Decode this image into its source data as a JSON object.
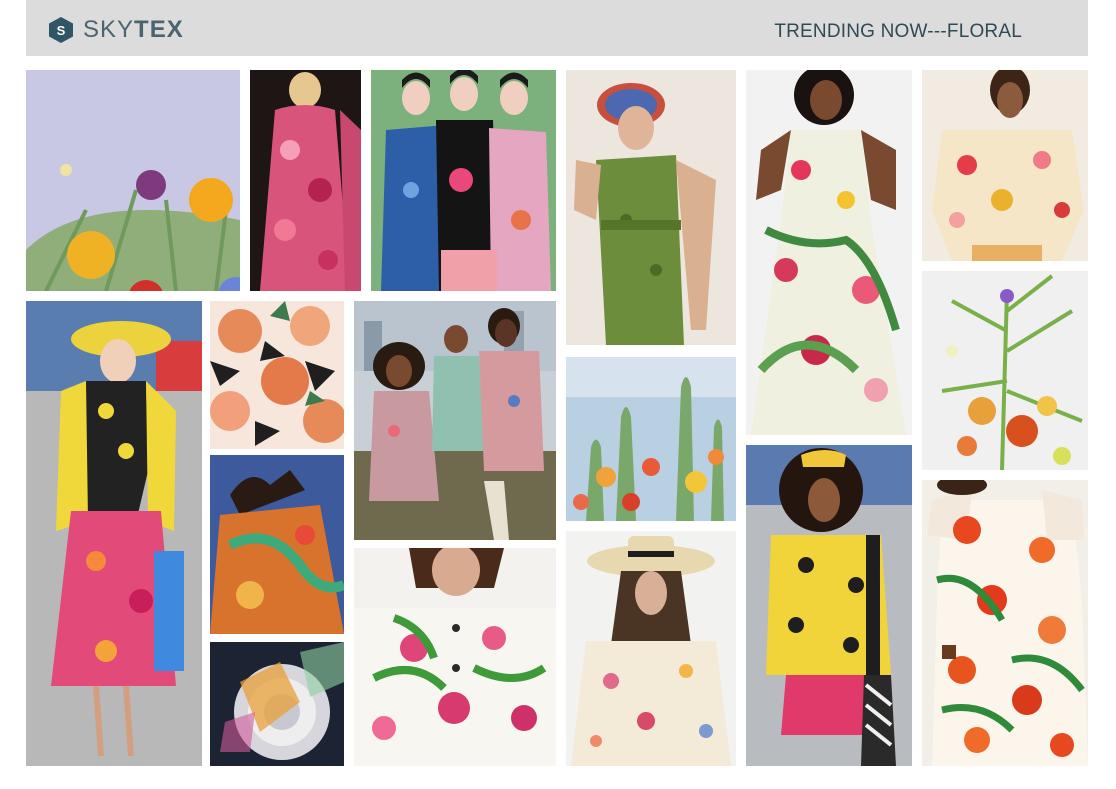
{
  "header": {
    "brand_light": "SKY",
    "brand_bold": "TEX",
    "logo_letter": "S",
    "title": "TRENDING NOW---FLORAL"
  },
  "colors": {
    "header_bg": "#dcdcdc",
    "brand": "#4a6470",
    "title": "#2f4a56"
  }
}
